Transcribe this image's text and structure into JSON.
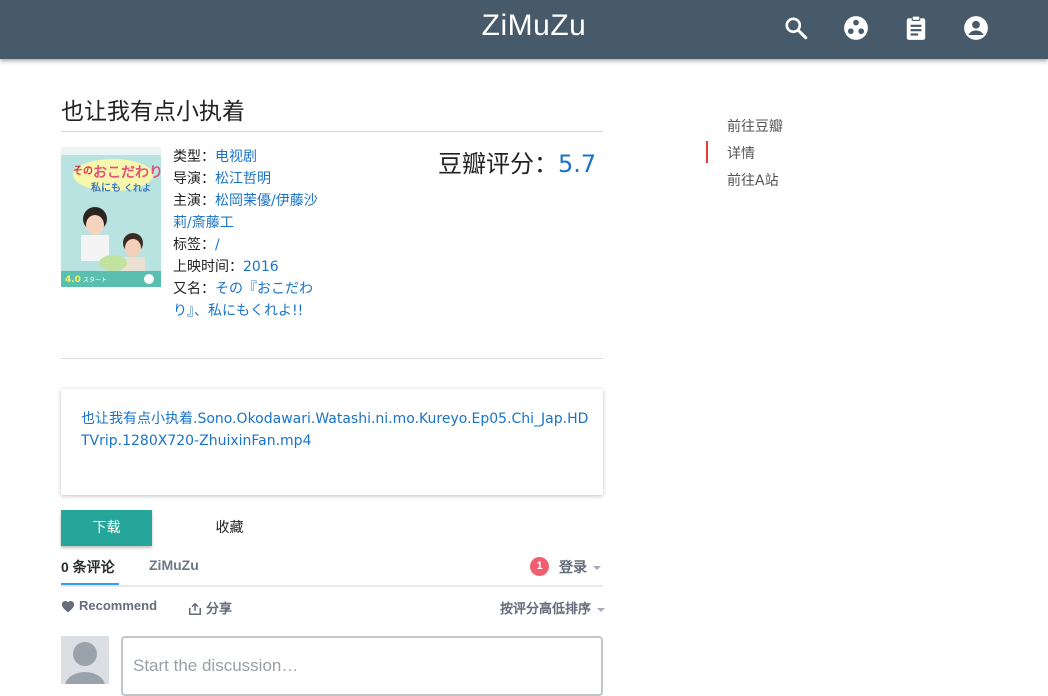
{
  "header": {
    "brand": "ZiMuZu",
    "icons": [
      "search-icon",
      "community-icon",
      "clipboard-icon",
      "account-icon"
    ],
    "bg_color": "#465a69"
  },
  "page": {
    "title": "也让我有点小执着"
  },
  "meta": {
    "type_label": "类型：",
    "type_value": "电视剧",
    "director_label": "导演：",
    "director_value": "松江哲明",
    "cast_label": "主演：",
    "cast_value": "松岡茉優/伊藤沙莉/斎藤工",
    "tags_label": "标签：",
    "tags_value": "/",
    "release_label": "上映时间：",
    "release_value": "2016",
    "alias_label": "又名：",
    "alias_value": "その『おこだわり』、私にもくれよ!!"
  },
  "rating": {
    "label": "豆瓣评分：",
    "score": "5.7"
  },
  "file": {
    "name": "也让我有点小执着.Sono.Okodawari.Watashi.ni.mo.Kureyo.Ep05.Chi_Jap.HDTVrip.1280X720-ZhuixinFan.mp4"
  },
  "actions": {
    "download": "下载",
    "favorite": "收藏",
    "download_color": "#26a69a"
  },
  "disqus": {
    "comments_tab": "0 条评论",
    "site_tab": "ZiMuZu",
    "notification_count": "1",
    "login": "登录",
    "recommend": "Recommend",
    "share": "分享",
    "sort": "按评分高低排序",
    "placeholder": "Start the discussion…"
  },
  "toc": {
    "items": [
      "前往豆瓣",
      "详情",
      "前往A站"
    ],
    "active_color": "#e53935"
  }
}
